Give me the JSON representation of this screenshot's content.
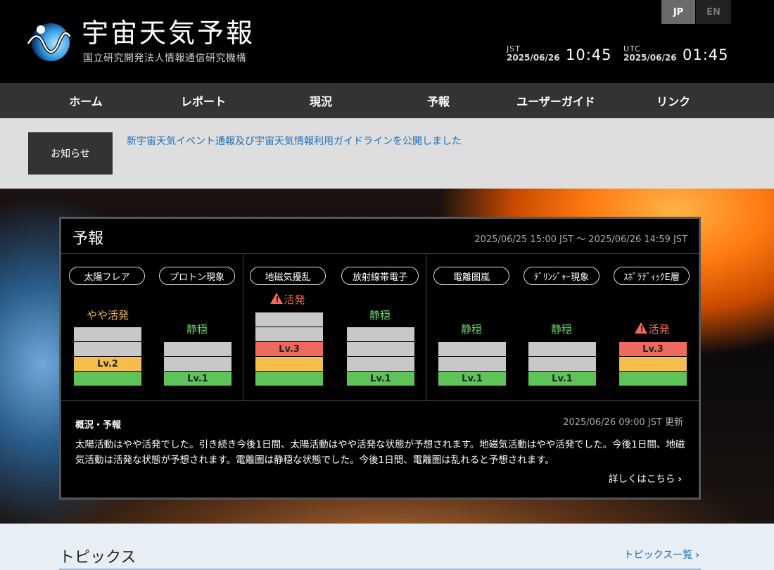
{
  "header": {
    "title": "宇宙天気予報",
    "subtitle": "国立研究開発法人情報通信研究機構",
    "lang": {
      "jp": "JP",
      "en": "EN"
    },
    "jst": {
      "zone": "JST",
      "date": "2025/06/26",
      "time": "10:45"
    },
    "utc": {
      "zone": "UTC",
      "date": "2025/06/26",
      "time": "01:45"
    }
  },
  "nav": [
    "ホーム",
    "レポート",
    "現況",
    "予報",
    "ユーザーガイド",
    "リンク"
  ],
  "notice": {
    "label": "お知らせ",
    "text": "新宇宙天気イベント通報及び宇宙天気情報利用ガイドラインを公開しました"
  },
  "forecast": {
    "title": "予報",
    "range": "2025/06/25 15:00 JST 〜 2025/06/26 14:59 JST",
    "items": [
      {
        "name": "太陽フレア",
        "status": "やや活発",
        "level": 2,
        "level_label": "Lv.2",
        "warn": false
      },
      {
        "name": "プロトン現象",
        "status": "静穏",
        "level": 1,
        "level_label": "Lv.1",
        "warn": false
      },
      {
        "name": "地磁気擾乱",
        "status": "活発",
        "level": 3,
        "level_label": "Lv.3",
        "warn": true
      },
      {
        "name": "放射線帯電子",
        "status": "静穏",
        "level": 1,
        "level_label": "Lv.1",
        "warn": false
      },
      {
        "name": "電離圏嵐",
        "status": "静穏",
        "level": 1,
        "level_label": "Lv.1",
        "warn": false
      },
      {
        "name": "ﾃﾞﾘﾝｼﾞｬｰ現象",
        "status": "静穏",
        "level": 1,
        "level_label": "Lv.1",
        "warn": false
      },
      {
        "name": "ｽﾎﾟﾗﾃﾞｨｯｸE層",
        "status": "活発",
        "level": 3,
        "level_label": "Lv.3",
        "warn": true
      }
    ],
    "summary_head": "概況・予報",
    "summary_updated": "2025/06/26 09:00 JST 更新",
    "summary_text": "太陽活動はやや活発でした。引き続き今後1日間、太陽活動はやや活発な状態が予想されます。地磁気活動はやや活発でした。今後1日間、地磁気活動は活発な状態が予想されます。電離圏は静穏な状態でした。今後1日間、電離圏は乱れると予想されます。",
    "more_link": "詳しくはこちら"
  },
  "topics": {
    "title": "トピックス",
    "link": "トピックス一覧"
  },
  "colors": {
    "level1": "#5ec45a",
    "level2": "#f5bd4c",
    "level3": "#ee6a5e",
    "inactive": "#c8c8c8",
    "link": "#1d6fb8"
  }
}
